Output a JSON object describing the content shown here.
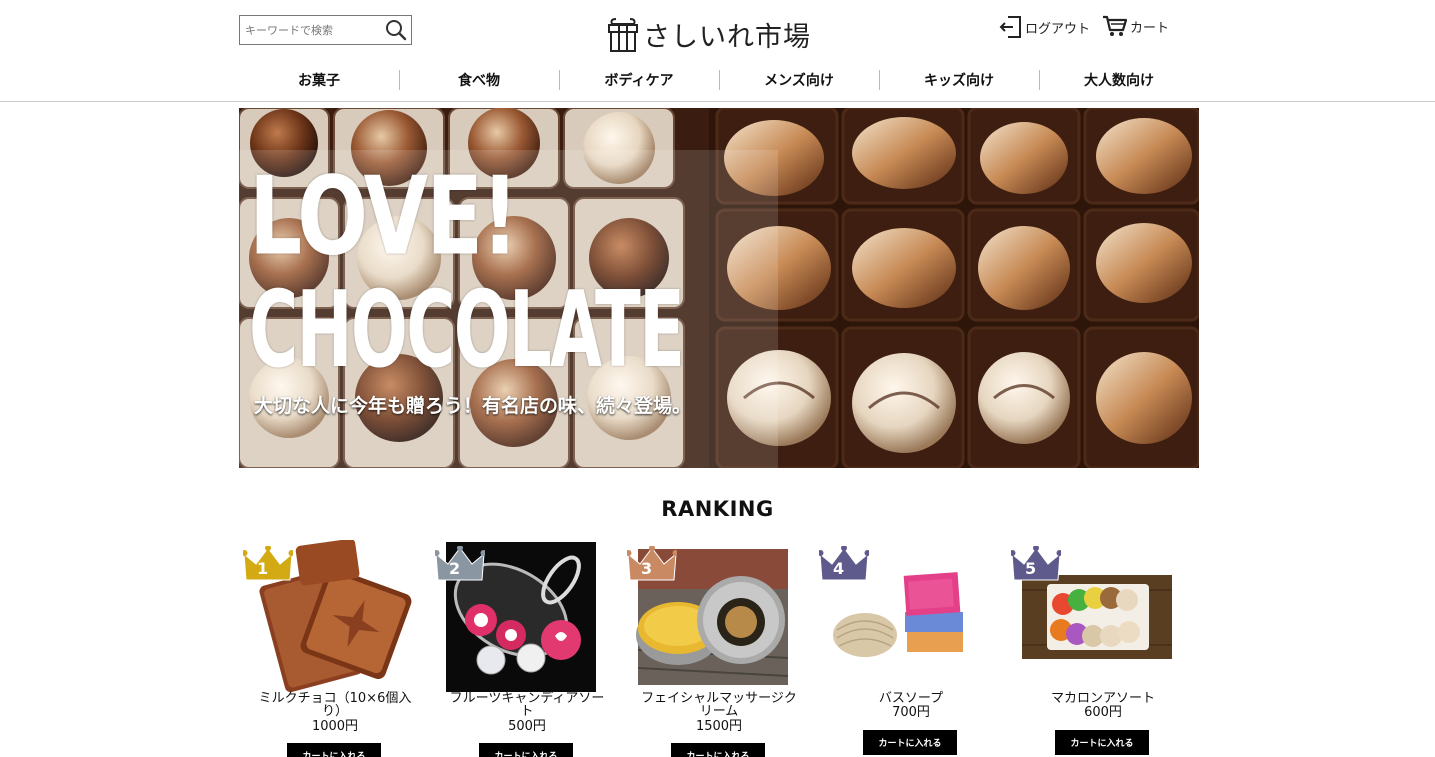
{
  "header": {
    "search": {
      "placeholder": "キーワードで検索",
      "icon": "search-icon"
    },
    "logo": {
      "text": "さしいれ市場",
      "icon": "gift-icon"
    },
    "logout_label": "ログアウト",
    "cart_label": "カート"
  },
  "nav": {
    "items": [
      {
        "label": "お菓子"
      },
      {
        "label": "食べ物"
      },
      {
        "label": "ボディケア"
      },
      {
        "label": "メンズ向け"
      },
      {
        "label": "キッズ向け"
      },
      {
        "label": "大人数向け"
      }
    ]
  },
  "hero": {
    "line1": "LOVE!",
    "line2": "CHOCOLATE",
    "subtitle": "大切な人に今年も贈ろう！有名店の味、続々登場。"
  },
  "ranking": {
    "title": "RANKING",
    "button_label": "カートに入れる",
    "items": [
      {
        "rank": "1",
        "name": "ミルクチョコ（10×6個入り）",
        "price": "1000円",
        "crown_color": "#d4aa14"
      },
      {
        "rank": "2",
        "name": "フルーツキャンディアソート",
        "price": "500円",
        "crown_color": "#8a97a3"
      },
      {
        "rank": "3",
        "name": "フェイシャルマッサージクリーム",
        "price": "1500円",
        "crown_color": "#c98a63"
      },
      {
        "rank": "4",
        "name": "バスソープ",
        "price": "700円",
        "crown_color": "#5e5a8c"
      },
      {
        "rank": "5",
        "name": "マカロンアソート",
        "price": "600円",
        "crown_color": "#5e5a8c"
      }
    ]
  }
}
